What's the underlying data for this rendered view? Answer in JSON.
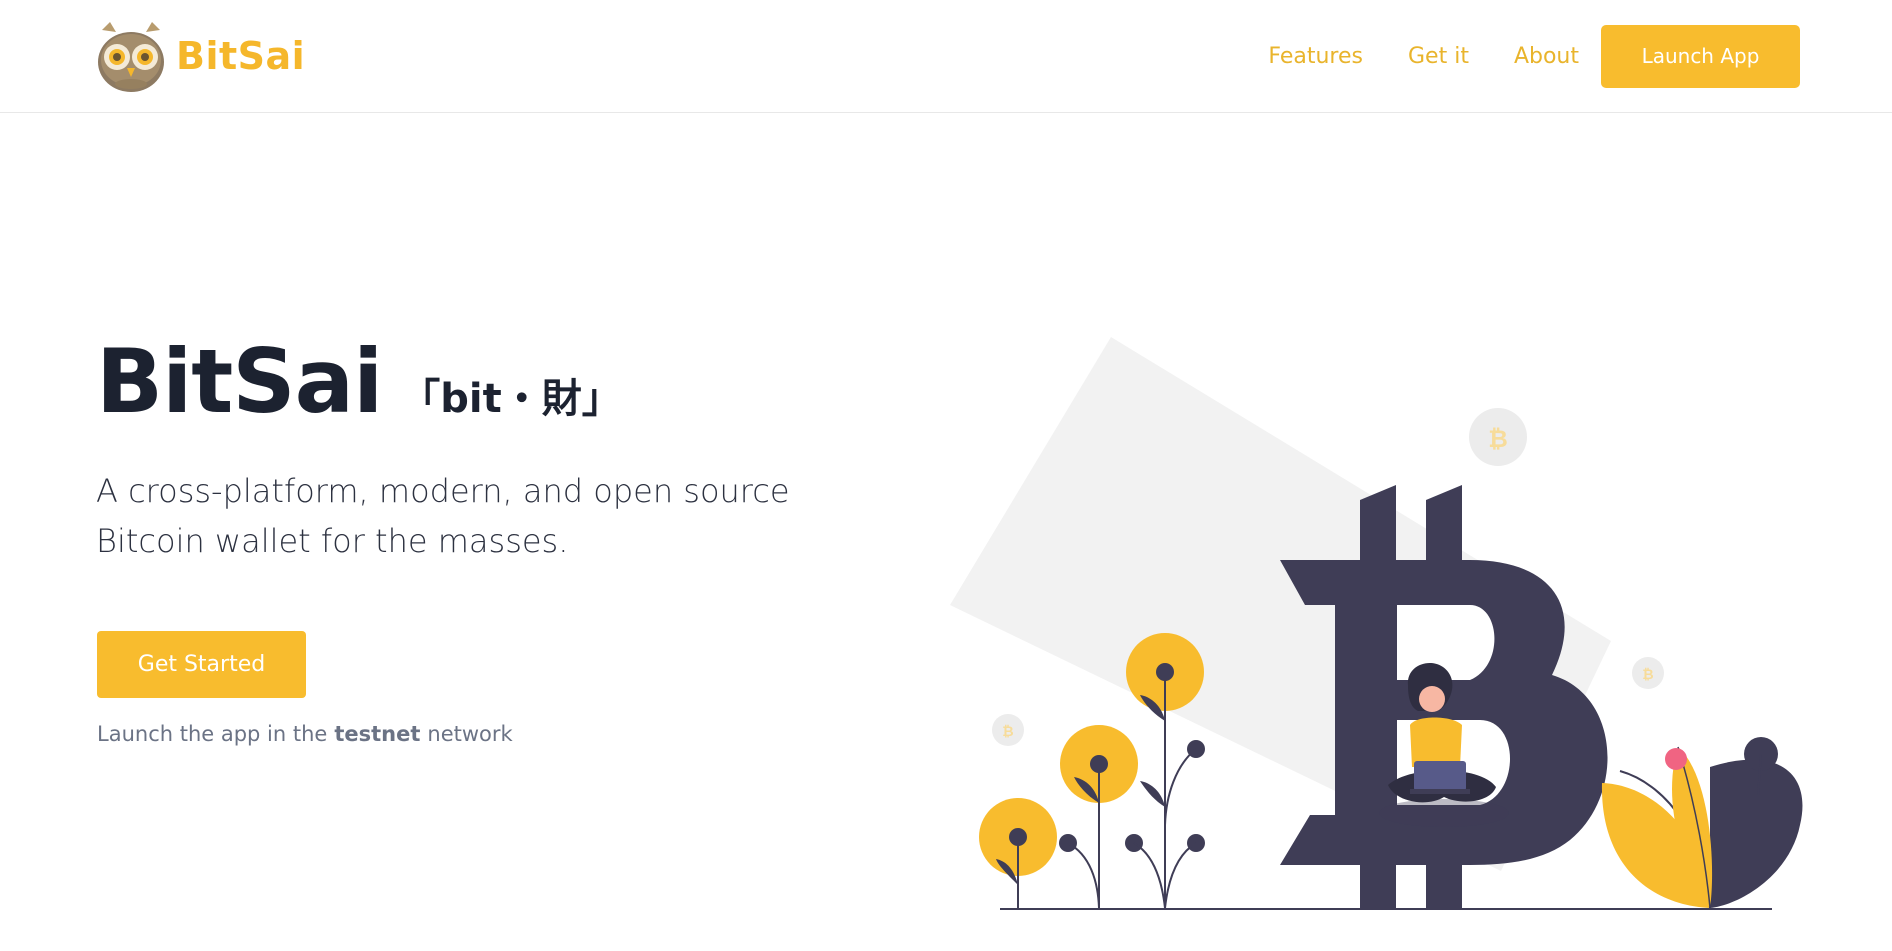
{
  "brand": {
    "name": "BitSai",
    "color": "#f5b72b"
  },
  "nav": {
    "links": [
      "Features",
      "Get it",
      "About"
    ],
    "launch_label": "Launch App"
  },
  "hero": {
    "title": "BitSai",
    "title_suffix": "「bit・財」",
    "tagline": "A cross-platform, modern, and open source Bitcoin wallet for the masses.",
    "cta_label": "Get Started",
    "note_prefix": "Launch the app in the",
    "note_highlight": "testnet",
    "note_suffix": "network"
  },
  "illustration": {
    "icon": "bitcoin-woman-laptop-illustration",
    "coin_symbol": "₿",
    "colors": {
      "accent": "#f8bc2e",
      "dark": "#3f3d56",
      "light_gray": "#f2f2f2",
      "pink": "#f06482"
    }
  }
}
